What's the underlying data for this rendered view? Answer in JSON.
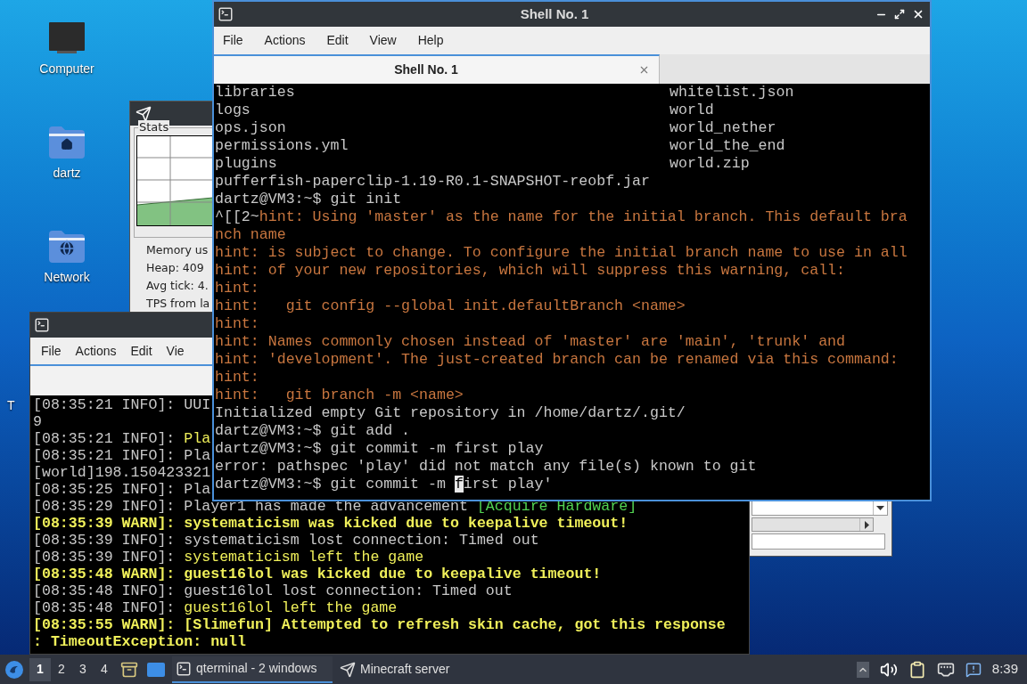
{
  "desktop_icons": [
    {
      "label": "Computer",
      "kind": "computer"
    },
    {
      "label": "dartz",
      "kind": "home"
    },
    {
      "label": "Network",
      "kind": "network"
    },
    {
      "label": "T",
      "kind": "covered"
    }
  ],
  "minecraft_window": {
    "group_title": "Stats",
    "readouts": [
      "Memory us",
      "Heap: 409",
      "Avg tick: 4.",
      "TPS from la"
    ]
  },
  "back_terminal": {
    "menu": [
      "File",
      "Actions",
      "Edit",
      "Vie"
    ],
    "lines": [
      {
        "segments": [
          {
            "text": "[08:35:21 INFO]: UUI",
            "kind": "plain"
          }
        ]
      },
      {
        "segments": [
          {
            "text": "9",
            "kind": "plain"
          }
        ]
      },
      {
        "segments": [
          {
            "text": "[08:35:21 INFO]: ",
            "kind": "plain"
          },
          {
            "text": "Pla",
            "kind": "yellow"
          }
        ]
      },
      {
        "segments": [
          {
            "text": "[08:35:21 INFO]: Pla",
            "kind": "plain"
          }
        ]
      },
      {
        "segments": [
          {
            "text": "[world]198.150423321",
            "kind": "plain"
          }
        ]
      },
      {
        "segments": [
          {
            "text": "[08:35:25 INFO]: Pla",
            "kind": "plain"
          }
        ]
      },
      {
        "segments": [
          {
            "text": "[08:35:29 INFO]: Player1 has made the advancement ",
            "kind": "plain"
          },
          {
            "text": "[Acquire Hardware]",
            "kind": "green"
          }
        ]
      },
      {
        "segments": [
          {
            "text": "[08:35:39 WARN]: systematicism was kicked due to keepalive timeout!",
            "kind": "warn"
          }
        ]
      },
      {
        "segments": [
          {
            "text": "[08:35:39 INFO]: systematicism lost connection: Timed out",
            "kind": "plain"
          }
        ]
      },
      {
        "segments": [
          {
            "text": "[08:35:39 INFO]: ",
            "kind": "plain"
          },
          {
            "text": "systematicism left the game",
            "kind": "yellow"
          }
        ]
      },
      {
        "segments": [
          {
            "text": "[08:35:48 WARN]: guest16lol was kicked due to keepalive timeout!",
            "kind": "warn"
          }
        ]
      },
      {
        "segments": [
          {
            "text": "[08:35:48 INFO]: guest16lol lost connection: Timed out",
            "kind": "plain"
          }
        ]
      },
      {
        "segments": [
          {
            "text": "[08:35:48 INFO]: ",
            "kind": "plain"
          },
          {
            "text": "guest16lol left the game",
            "kind": "yellow"
          }
        ]
      },
      {
        "segments": [
          {
            "text": "[08:35:55 WARN]: [Slimefun] Attempted to refresh skin cache, got this response",
            "kind": "warn"
          }
        ]
      },
      {
        "segments": [
          {
            "text": ": TimeoutException: null",
            "kind": "warn"
          }
        ]
      }
    ]
  },
  "shell": {
    "title": "Shell No. 1",
    "menu": [
      "File",
      "Actions",
      "Edit",
      "View",
      "Help"
    ],
    "tabs": [
      {
        "label": "Shell No. 1",
        "selected": true
      }
    ],
    "listing": [
      [
        "libraries",
        "whitelist.json"
      ],
      [
        "logs",
        "world"
      ],
      [
        "ops.json",
        "world_nether"
      ],
      [
        "permissions.yml",
        "world_the_end"
      ],
      [
        "plugins",
        "world.zip"
      ]
    ],
    "lines": [
      {
        "segments": [
          {
            "text": "pufferfish-paperclip-1.19-R0.1-SNAPSHOT-reobf.jar",
            "kind": "plain"
          }
        ]
      },
      {
        "segments": [
          {
            "text": "dartz@VM3:~$ git init",
            "kind": "plain"
          }
        ]
      },
      {
        "segments": [
          {
            "text": "^[[2~",
            "kind": "plain"
          },
          {
            "text": "hint: Using 'master' as the name for the initial branch. This default bra",
            "kind": "hint"
          }
        ]
      },
      {
        "segments": [
          {
            "text": "nch name",
            "kind": "hint"
          }
        ]
      },
      {
        "segments": [
          {
            "text": "hint: is subject to change. To configure the initial branch name to use in all",
            "kind": "hint"
          }
        ]
      },
      {
        "segments": [
          {
            "text": "hint: of your new repositories, which will suppress this warning, call:",
            "kind": "hint"
          }
        ]
      },
      {
        "segments": [
          {
            "text": "hint:",
            "kind": "hint"
          }
        ]
      },
      {
        "segments": [
          {
            "text": "hint:   git config --global init.defaultBranch <name>",
            "kind": "hint"
          }
        ]
      },
      {
        "segments": [
          {
            "text": "hint:",
            "kind": "hint"
          }
        ]
      },
      {
        "segments": [
          {
            "text": "hint: Names commonly chosen instead of 'master' are 'main', 'trunk' and",
            "kind": "hint"
          }
        ]
      },
      {
        "segments": [
          {
            "text": "hint: 'development'. The just-created branch can be renamed via this command:",
            "kind": "hint"
          }
        ]
      },
      {
        "segments": [
          {
            "text": "hint:",
            "kind": "hint"
          }
        ]
      },
      {
        "segments": [
          {
            "text": "hint:   git branch -m <name>",
            "kind": "hint"
          }
        ]
      },
      {
        "segments": [
          {
            "text": "Initialized empty Git repository in /home/dartz/.git/",
            "kind": "plain"
          }
        ]
      },
      {
        "segments": [
          {
            "text": "dartz@VM3:~$ git add .",
            "kind": "plain"
          }
        ]
      },
      {
        "segments": [
          {
            "text": "dartz@VM3:~$ git commit -m first play",
            "kind": "plain"
          }
        ]
      },
      {
        "segments": [
          {
            "text": "error: pathspec 'play' did not match any file(s) known to git",
            "kind": "plain"
          }
        ]
      },
      {
        "segments": [
          {
            "text": "dartz@VM3:~$ git commit -m ",
            "kind": "plain"
          },
          {
            "text": "f",
            "kind": "cursor"
          },
          {
            "text": "irst play'",
            "kind": "plain"
          }
        ]
      }
    ]
  },
  "taskbar": {
    "workspaces": [
      {
        "label": "1",
        "selected": true
      },
      {
        "label": "2",
        "selected": false
      },
      {
        "label": "3",
        "selected": false
      },
      {
        "label": "4",
        "selected": false
      }
    ],
    "tasks": [
      {
        "label": "qterminal - 2 windows",
        "kind": "terminal",
        "selected": true
      },
      {
        "label": "Minecraft server",
        "kind": "minecraft",
        "selected": false
      }
    ],
    "clock": "8:39"
  }
}
